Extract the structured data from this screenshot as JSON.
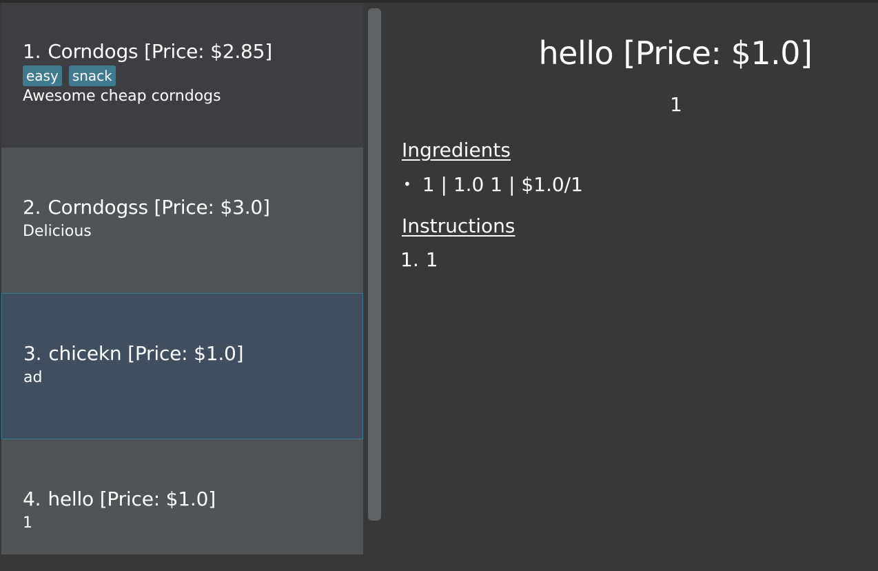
{
  "recipes": [
    {
      "index": "1.",
      "title": "Corndogs [Price: $2.85]",
      "tags": [
        "easy",
        "snack"
      ],
      "description": "Awesome cheap corndogs"
    },
    {
      "index": "2.",
      "title": "Corndogss [Price: $3.0]",
      "tags": [],
      "description": "Delicious"
    },
    {
      "index": "3.",
      "title": "chicekn [Price: $1.0]",
      "tags": [],
      "description": "ad"
    },
    {
      "index": "4.",
      "title": "hello [Price: $1.0]",
      "tags": [],
      "description": "1"
    }
  ],
  "detail": {
    "title": "hello [Price: $1.0]",
    "description": "1",
    "ingredients_heading": "Ingredients",
    "ingredients": [
      {
        "bullet": "•",
        "text": "1 | 1.0 1 | $1.0/1"
      }
    ],
    "instructions_heading": "Instructions",
    "instructions": [
      {
        "number": "1.",
        "text": "1"
      }
    ]
  },
  "colors": {
    "background": "#383838",
    "card_odd": "#3c3e41",
    "card_even": "#505457",
    "card_selected": "#414e60",
    "selected_border": "#2f7f8e",
    "tag": "#3f7a8f",
    "scroll_thumb": "#606366"
  }
}
